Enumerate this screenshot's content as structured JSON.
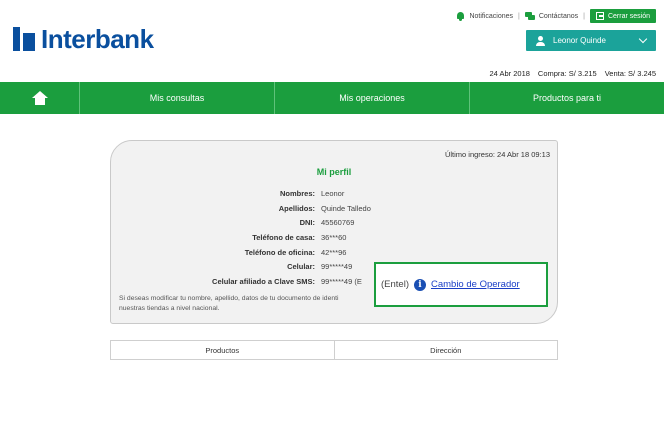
{
  "brand": {
    "name": "Interbank"
  },
  "top_links": {
    "notifications": "Notificaciones",
    "contact": "Contáctanos",
    "logout": "Cerrar sesión"
  },
  "user": {
    "name": "Leonor Quinde"
  },
  "rates": {
    "date": "24 Abr 2018",
    "buy": "Compra: S/  3.215",
    "sell": "Venta: S/  3.245"
  },
  "nav": {
    "items": [
      {
        "label": "Mis consultas"
      },
      {
        "label": "Mis operaciones"
      },
      {
        "label": "Productos para ti"
      }
    ]
  },
  "profile": {
    "last_login": "Último ingreso: 24 Abr 18 09:13",
    "title": "Mi perfil",
    "fields": [
      {
        "label": "Nombres:",
        "value": "Leonor"
      },
      {
        "label": "Apellidos:",
        "value": "Quinde Talledo"
      },
      {
        "label": "DNI:",
        "value": "45560769"
      },
      {
        "label": "Teléfono de casa:",
        "value": "36***60"
      },
      {
        "label": "Teléfono de oficina:",
        "value": "42***96"
      },
      {
        "label": "Celular:",
        "value": "99*****49"
      },
      {
        "label": "Celular afiliado a Clave SMS:",
        "value": "99*****49 (E"
      }
    ],
    "note_line1": "Si deseas modificar tu nombre, apellido, datos de tu documento de identi",
    "note_line2": "nuestras tiendas a nivel nacional.",
    "operator": {
      "entel": "(Entel)",
      "info_icon": "i",
      "link": "Cambio de Operador"
    }
  },
  "table": {
    "headers": [
      "Productos",
      "Dirección"
    ]
  },
  "colors": {
    "brand_blue": "#0a4f9e",
    "green": "#1b9e3e",
    "teal": "#1ba39a",
    "link_blue": "#1a3ec6"
  }
}
